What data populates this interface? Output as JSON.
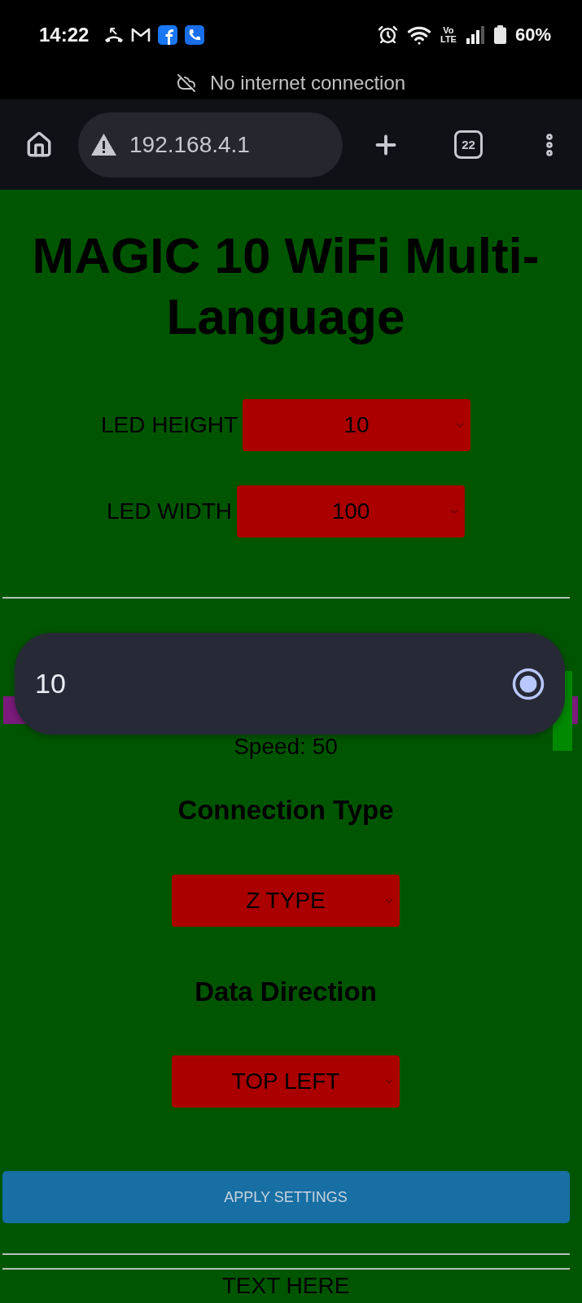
{
  "status_bar": {
    "time": "14:22",
    "network_type": [
      "Vo",
      "LTE"
    ],
    "battery": "60%"
  },
  "notice": {
    "text": "No internet connection"
  },
  "browser": {
    "url": "192.168.4.1",
    "tab_count": "22"
  },
  "page": {
    "title": "MAGIC 10 WiFi Multi-Language",
    "size_fields": [
      {
        "label": "LED HEIGHT",
        "value": "10"
      },
      {
        "label": "LED WIDTH",
        "value": "100"
      }
    ],
    "speed_slider": {
      "level": 0.99
    },
    "speed_label": "Speed: 50",
    "sections": [
      {
        "heading": "Connection Type",
        "value": "Z TYPE"
      },
      {
        "heading": "Data Direction",
        "value": "TOP LEFT"
      }
    ],
    "apply_button": "APPLY SETTINGS",
    "text_heading": "TEXT HERE"
  },
  "picker": {
    "options": [
      {
        "label": "10",
        "selected": true
      }
    ]
  }
}
